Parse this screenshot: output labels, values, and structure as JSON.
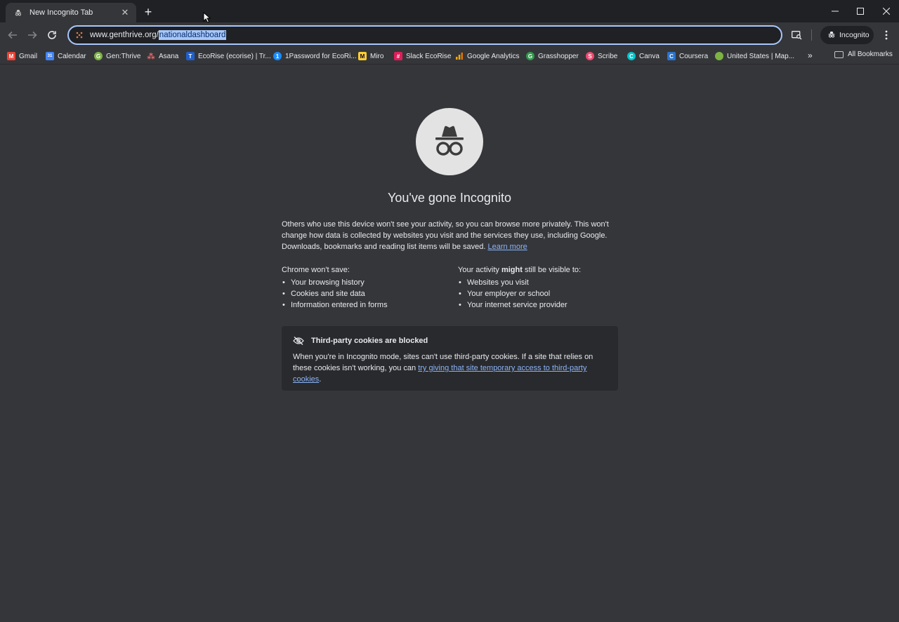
{
  "browser": {
    "tab": {
      "title": "New Incognito Tab",
      "icon": "incognito-icon"
    },
    "new_tab_label": "+",
    "window_controls": [
      "minimize",
      "maximize",
      "close"
    ],
    "omnibox": {
      "url_prefix": "www.genthrive.org/",
      "url_selected": "nationaldashboard"
    },
    "incognito_chip": "Incognito"
  },
  "bookmarks": [
    {
      "label": "Gmail",
      "color": "#ea4335",
      "glyph": "M"
    },
    {
      "label": "Calendar",
      "color": "#4285f4",
      "glyph": "31"
    },
    {
      "label": "Gen:Thrive",
      "color": "#7cb342",
      "glyph": "G"
    },
    {
      "label": "Asana",
      "color": "#f06a6a",
      "glyph": "⁂"
    },
    {
      "label": "EcoRise (ecorise) | Tr...",
      "color": "#1f5fcc",
      "glyph": "T"
    },
    {
      "label": "1Password for EcoRi...",
      "color": "#1a8cff",
      "glyph": "1"
    },
    {
      "label": "Miro",
      "color": "#ffd02f",
      "glyph": "M"
    },
    {
      "label": "Slack EcoRise",
      "color": "#e01e5a",
      "glyph": "#"
    },
    {
      "label": "Google Analytics",
      "color": "#f9ab00",
      "glyph": "▮"
    },
    {
      "label": "Grasshopper",
      "color": "#2e9b4a",
      "glyph": "G"
    },
    {
      "label": "Scribe",
      "color": "#ef4a6f",
      "glyph": "S"
    },
    {
      "label": "Canva",
      "color": "#00c4cc",
      "glyph": "C"
    },
    {
      "label": "Coursera",
      "color": "#2a73cc",
      "glyph": "C"
    },
    {
      "label": "United States | Map...",
      "color": "#7cb342",
      "glyph": "●"
    }
  ],
  "bookmarks_overflow": "»",
  "all_bookmarks": "All Bookmarks",
  "page": {
    "title": "You've gone Incognito",
    "intro": "Others who use this device won't see your activity, so you can browse more privately. This won't change how data is collected by websites you visit and the services they use, including Google. Downloads, bookmarks and reading list items will be saved.",
    "learn_more": "Learn more",
    "wont_save": {
      "title": "Chrome won't save:",
      "items": [
        "Your browsing history",
        "Cookies and site data",
        "Information entered in forms"
      ]
    },
    "might_be_visible": {
      "title_pre": "Your activity ",
      "title_bold": "might",
      "title_post": " still be visible to:",
      "items": [
        "Websites you visit",
        "Your employer or school",
        "Your internet service provider"
      ]
    },
    "cookies": {
      "title": "Third-party cookies are blocked",
      "body": "When you're in Incognito mode, sites can't use third-party cookies. If a site that relies on these cookies isn't working, you can ",
      "link": "try giving that site temporary access to third-party cookies",
      "end": "."
    }
  }
}
